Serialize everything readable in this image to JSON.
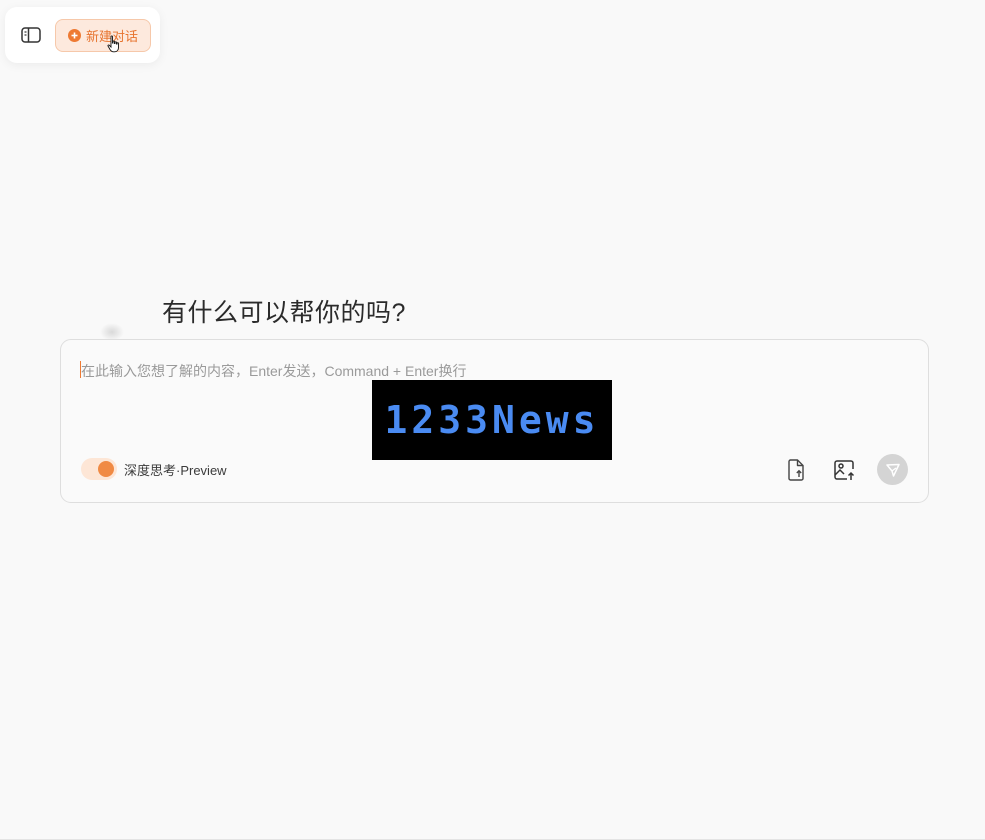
{
  "toolbar": {
    "sidebar_icon": "sidebar-panel-icon",
    "new_chat_label": "新建对话",
    "new_chat_icon": "plus-circle-icon"
  },
  "main": {
    "greeting": "有什么可以帮你的吗?"
  },
  "composer": {
    "placeholder": "在此输入您想了解的内容，Enter发送，Command + Enter换行",
    "watermark": "1233News",
    "deep_think_label": "深度思考·Preview",
    "deep_think_enabled": true,
    "actions": [
      {
        "name": "upload-file",
        "icon": "file-upload-icon"
      },
      {
        "name": "upload-image",
        "icon": "image-upload-icon"
      },
      {
        "name": "send",
        "icon": "send-icon"
      }
    ]
  },
  "colors": {
    "accent": "#ee7a33",
    "accent_bg": "#fde9dd",
    "send_disabled": "#d4d4d4",
    "watermark_text": "#4a8bf2"
  }
}
